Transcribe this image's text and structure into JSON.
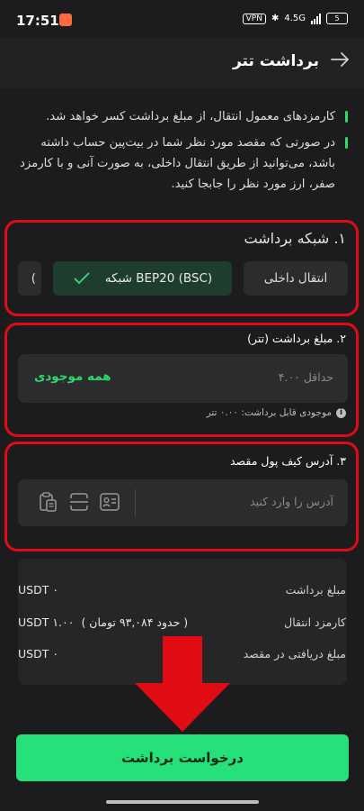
{
  "status_bar": {
    "time": "17:51",
    "vpn": "VPN",
    "network": "4.5G",
    "battery": "5"
  },
  "header": {
    "title": "برداشت تتر"
  },
  "notes": [
    "کارمزدهای معمول انتقال، از مبلغ برداشت کسر خواهد شد.",
    "در صورتی که مقصد مورد نظر شما در بیت‌پین حساب داشته باشد، می‌توانید از طریق انتقال داخلی، به صورت آنی و با کارمزد صفر، ارز مورد نظر را جابجا کنید."
  ],
  "network_section": {
    "title": "۱. شبکه برداشت",
    "options": [
      "انتقال داخلی",
      "BEP20 (BSC) شبکه",
      "("
    ],
    "selected": "BEP20 (BSC) شبکه"
  },
  "amount_section": {
    "title": "۲. مبلغ برداشت (تتر)",
    "placeholder": "حداقل ۴.۰۰",
    "all_balance": "همه موجودی",
    "available": "موجودی قابل برداشت: ۰.۰۰ تتر"
  },
  "address_section": {
    "title": "۳. آدرس کیف پول مقصد",
    "placeholder": "آدرس را وارد کنید"
  },
  "summary": {
    "rows": [
      {
        "label": "مبلغ برداشت",
        "value": "USDT ۰"
      },
      {
        "label": "کارمزد انتقال",
        "value": "USDT ۱.۰۰",
        "note": "( حدود ۹۳,۰۸۴ تومان )"
      },
      {
        "label": "مبلغ دریافتی در مقصد",
        "value": "USDT ۰"
      }
    ]
  },
  "cta": {
    "label": "درخواست برداشت"
  },
  "colors": {
    "accent": "#26e07a",
    "annotation_red": "#e10b13",
    "bg": "#1c1c1e"
  }
}
